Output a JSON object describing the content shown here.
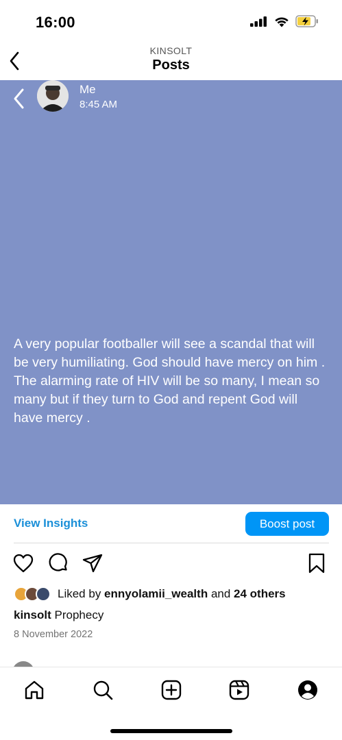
{
  "status_bar": {
    "time": "16:00",
    "icons": [
      "signal-icon",
      "wifi-icon",
      "battery-charging-icon"
    ]
  },
  "header": {
    "subtitle": "KINSOLT",
    "title": "Posts",
    "back_icon": "back-chevron-icon"
  },
  "post": {
    "background_color": "#8092c7",
    "author": "Me",
    "time": "8:45 AM",
    "text": "A very popular footballer will see a scandal that will\nbe very humiliating. God should have mercy on him .    The alarming rate of HIV will be so many, I mean so many but if they turn to God and repent God will have mercy ."
  },
  "insights": {
    "view_label": "View Insights",
    "boost_label": "Boost post",
    "accent_color": "#0095f6"
  },
  "actions": [
    "heart-icon",
    "comment-icon",
    "share-icon",
    "bookmark-icon"
  ],
  "likes": {
    "prefix": "Liked by ",
    "user": "ennyolamii_wealth",
    "middle": " and ",
    "others": "24 others"
  },
  "caption": {
    "username": "kinsolt",
    "text": " Prophecy"
  },
  "date": "8 November 2022",
  "bottom_nav": [
    "home-icon",
    "search-icon",
    "create-icon",
    "reels-icon",
    "profile-icon"
  ]
}
